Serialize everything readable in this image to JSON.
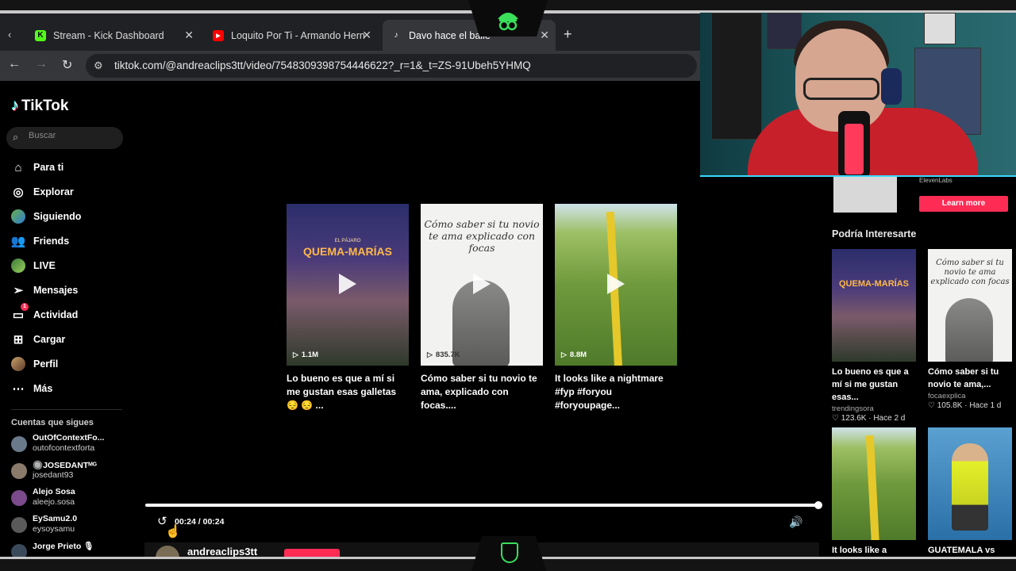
{
  "browser": {
    "tabs": [
      {
        "title": "Stream - Kick Dashboard",
        "icon": "kick-icon",
        "color": "#53fc18"
      },
      {
        "title": "Loquito Por Ti - Armando Hern",
        "icon": "youtube-icon",
        "color": "#ff0000"
      },
      {
        "title": "Davo hace el baile",
        "icon": "tiktok-icon",
        "color": "#ffffff"
      }
    ],
    "url": "tiktok.com/@andreaclips3tt/video/7548309398754446622?_r=1&_t=ZS-91Ubeh5YHMQ"
  },
  "tiktok": {
    "brand": "TikTok",
    "search_placeholder": "Buscar",
    "nav": [
      {
        "label": "Para ti",
        "icon": "home-icon"
      },
      {
        "label": "Explorar",
        "icon": "compass-icon"
      },
      {
        "label": "Siguiendo",
        "icon": "avatar-icon"
      },
      {
        "label": "Friends",
        "icon": "friends-icon"
      },
      {
        "label": "LIVE",
        "icon": "live-avatar-icon"
      },
      {
        "label": "Mensajes",
        "icon": "send-icon"
      },
      {
        "label": "Actividad",
        "icon": "inbox-icon",
        "badge": "1"
      },
      {
        "label": "Cargar",
        "icon": "plus-square-icon"
      },
      {
        "label": "Perfil",
        "icon": "profile-avatar-icon"
      },
      {
        "label": "Más",
        "icon": "more-icon"
      }
    ],
    "following_title": "Cuentas que sigues",
    "following": [
      {
        "name": "OutOfContextFo...",
        "handle": "outofcontextforta"
      },
      {
        "name": "🔘JOSEDANTᴹᴳ",
        "handle": "josedant93"
      },
      {
        "name": "Alejo Sosa",
        "handle": "aleejo.sosa"
      },
      {
        "name": "EySamu2.0",
        "handle": "eysoysamu"
      },
      {
        "name": "Jorge Prieto 🎙",
        "handle": ""
      }
    ]
  },
  "player": {
    "recommended": [
      {
        "views": "1.1M",
        "caption": "Lo bueno es que a mí si me gustan esas galletas 😔 😔 ...",
        "thumb_title": "QUEMA-MARÍAS",
        "thumb_kicker": "EL PÁJARO"
      },
      {
        "views": "835.7K",
        "caption": "Cómo saber si tu novio te ama, explicado con focas....",
        "thumb_title": "Cómo saber si tu novio te ama explicado con focas"
      },
      {
        "views": "8.8M",
        "caption": "It looks like a nightmare #fyp #foryou #foryoupage..."
      }
    ],
    "time": "00:24 / 00:24",
    "author": "andreaclips3tt",
    "progress": 1.0
  },
  "right": {
    "ad_brand": "ElevenLabs",
    "learn_more": "Learn more",
    "section_title": "Podría Interesarte",
    "suggestions": [
      {
        "caption": "Lo bueno es que a mí si me gustan esas...",
        "author": "trendingsora",
        "meta": "♡ 123.6K · Hace 2 d"
      },
      {
        "caption": "Cómo saber si tu novio te ama,...",
        "author": "focaexplica",
        "meta": "♡ 105.8K · Hace 1 d"
      },
      {
        "caption": "It looks like a",
        "author": "",
        "meta": ""
      },
      {
        "caption": "GUATEMALA vs",
        "author": "",
        "meta": ""
      }
    ]
  },
  "colors": {
    "accent": "#fe2c55",
    "frame_green": "#3adf5a",
    "cam_glow": "#3ad8ff"
  }
}
